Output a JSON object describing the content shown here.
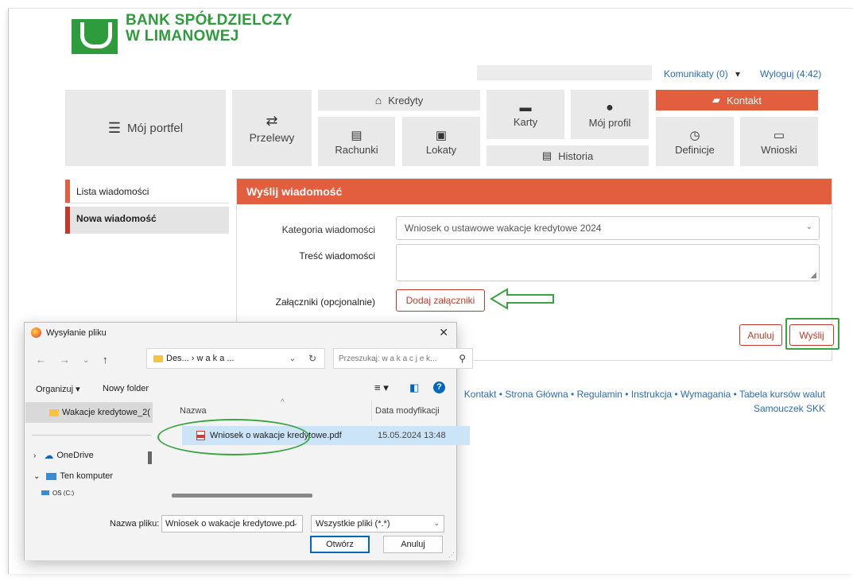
{
  "bank": {
    "line1": "BANK SPÓŁDZIELCZY",
    "line2": "W LIMANOWEJ"
  },
  "topbar": {
    "messages": "Komunikaty (0)",
    "messages_arrow": "▾",
    "logout": "Wyloguj (4:42)"
  },
  "nav": {
    "portfolio": "Mój portfel",
    "transfers": "Przelewy",
    "credits": "Kredyty",
    "accounts": "Rachunki",
    "deposits": "Lokaty",
    "cards": "Karty",
    "profile": "Mój profil",
    "history": "Historia",
    "contact": "Kontakt",
    "definitions": "Definicje",
    "applications": "Wnioski"
  },
  "sidebar": {
    "items": [
      {
        "label": "Lista wiadomości"
      },
      {
        "label": "Nowa wiadomość"
      }
    ]
  },
  "form": {
    "title": "Wyślij wiadomość",
    "category_label": "Kategoria wiadomości",
    "category_value": "Wniosek o ustawowe wakacje kredytowe 2024",
    "content_label": "Treść wiadomości",
    "attachments_label": "Załączniki (opcjonalnie)",
    "add_attachments": "Dodaj załączniki",
    "cancel": "Anuluj",
    "send": "Wyślij"
  },
  "footer": {
    "links": "Kontakt • Strona Główna • Regulamin • Instrukcja • Wymagania • Tabela kursów walut",
    "links2": "Samouczek SKK"
  },
  "dialog": {
    "title": "Wysyłanie pliku",
    "path": "Des... › w a k a ...",
    "search_placeholder": "Przeszukaj: w a k a c j e  k...",
    "organize": "Organizuj ▾",
    "new_folder": "Nowy folder",
    "nav_items": [
      "Wakacje kredytowe_2(",
      "OneDrive",
      "Ten komputer",
      "OS (C:)"
    ],
    "col_name": "Nazwa",
    "col_date": "Data modyfikacji",
    "file_name": "Wniosek o wakacje kredytowe.pdf",
    "file_date": "15.05.2024 13:48",
    "filename_label": "Nazwa pliku:",
    "filename_value": "Wniosek o wakacje kredytowe.pd",
    "filetype_value": "Wszystkie pliki (*.*)",
    "open": "Otwórz",
    "cancel": "Anuluj"
  },
  "colors": {
    "accent": "#e35d3f",
    "brand_green": "#2e9b3c",
    "link": "#2a6db6"
  }
}
